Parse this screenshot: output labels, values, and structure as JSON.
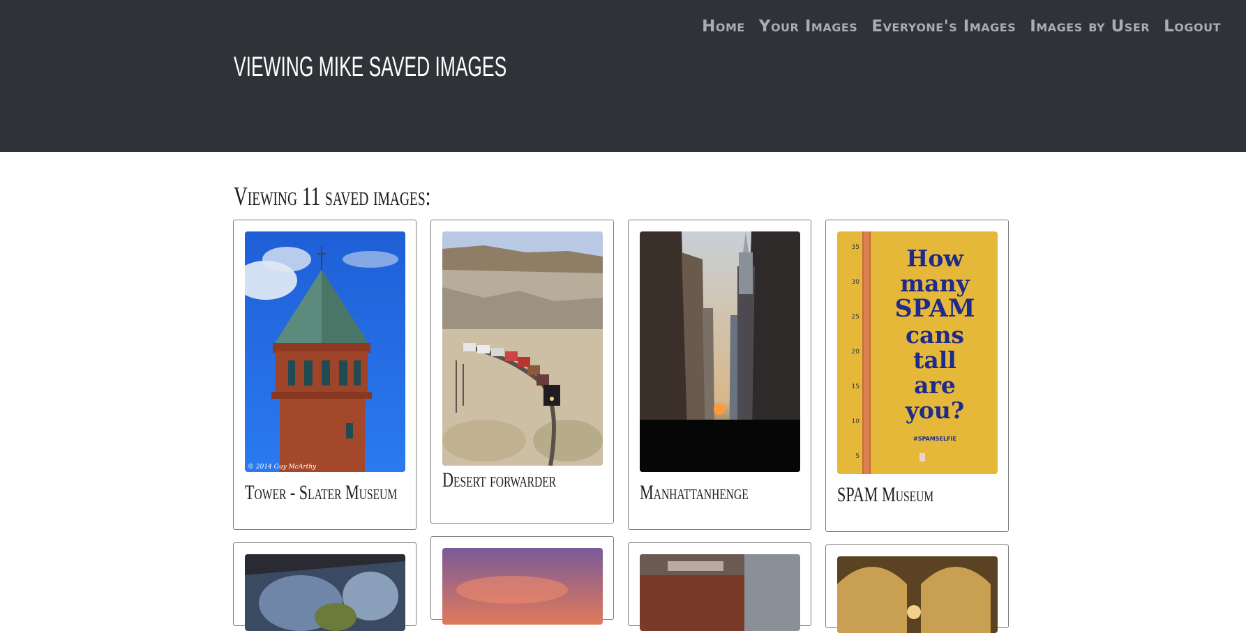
{
  "nav": {
    "items": [
      {
        "label": "Home"
      },
      {
        "label": "Your Images"
      },
      {
        "label": "Everyone's Images"
      },
      {
        "label": "Images by User"
      },
      {
        "label": "Logout"
      }
    ]
  },
  "header": {
    "title": "VIEWING MIKE SAVED IMAGES"
  },
  "main": {
    "heading": "Viewing 11 saved images:",
    "images": [
      {
        "caption": "Tower - Slater Museum",
        "watermark": "© 2014 Guy McArthy"
      },
      {
        "caption": "Desert forwarder"
      },
      {
        "caption": "Manhattanhenge"
      },
      {
        "caption": "SPAM Museum",
        "sign_text": [
          "How",
          "many",
          "SPAM",
          "cans",
          "tall",
          "are",
          "you?"
        ],
        "hashtag": "#SPAMSELFIE",
        "ruler_marks": [
          "35",
          "30",
          "25",
          "20",
          "15",
          "10",
          "5"
        ]
      },
      {
        "caption": ""
      },
      {
        "caption": ""
      },
      {
        "caption": ""
      },
      {
        "caption": ""
      }
    ]
  },
  "colors": {
    "header_bg": "#2f3337",
    "nav_text": "#a9adb1",
    "card_border": "#7d7d7d"
  }
}
